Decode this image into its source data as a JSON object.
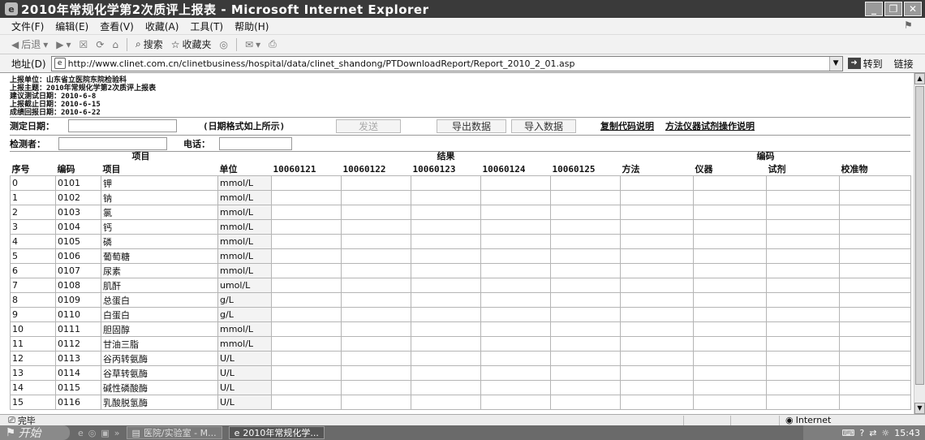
{
  "window": {
    "title": "2010年常规化学第2次质评上报表 - Microsoft Internet Explorer"
  },
  "menu": [
    "文件(F)",
    "编辑(E)",
    "查看(V)",
    "收藏(A)",
    "工具(T)",
    "帮助(H)"
  ],
  "toolbar": {
    "back": "后退",
    "search": "搜索",
    "favorites": "收藏夹"
  },
  "address": {
    "label": "地址(D)",
    "url": "http://www.clinet.com.cn/clinetbusiness/hospital/data/clinet_shandong/PTDownloadReport/Report_2010_2_01.asp",
    "go": "转到",
    "links": "链接"
  },
  "info": [
    "上报单位：山东省立医院东院检验科",
    "上报主题：2010年常规化学第2次质评上报表",
    "建议测试日期：2010-6-8",
    "上报截止日期：2010-6-15",
    "成绩回报日期：2010-6-22"
  ],
  "form": {
    "test_date_label": "测定日期：",
    "date_hint": "(日期格式如上所示)",
    "send": "发送",
    "export": "导出数据",
    "import": "导入数据",
    "code_help": "复制代码说明",
    "method_help": "方法仪器试剂操作说明",
    "tester_label": "检测者：",
    "phone_label": "电话："
  },
  "table": {
    "group_headers": {
      "item": "项目",
      "result": "结果",
      "code": "编码"
    },
    "headers": [
      "序号",
      "编码",
      "项目",
      "单位",
      "10060121",
      "10060122",
      "10060123",
      "10060124",
      "10060125",
      "方法",
      "仪器",
      "试剂",
      "校准物"
    ],
    "rows": [
      [
        "0",
        "0101",
        "钾",
        "mmol/L"
      ],
      [
        "1",
        "0102",
        "钠",
        "mmol/L"
      ],
      [
        "2",
        "0103",
        "氯",
        "mmol/L"
      ],
      [
        "3",
        "0104",
        "钙",
        "mmol/L"
      ],
      [
        "4",
        "0105",
        "磷",
        "mmol/L"
      ],
      [
        "5",
        "0106",
        "葡萄糖",
        "mmol/L"
      ],
      [
        "6",
        "0107",
        "尿素",
        "mmol/L"
      ],
      [
        "7",
        "0108",
        "肌酐",
        "umol/L"
      ],
      [
        "8",
        "0109",
        "总蛋白",
        "g/L"
      ],
      [
        "9",
        "0110",
        "白蛋白",
        "g/L"
      ],
      [
        "10",
        "0111",
        "胆固醇",
        "mmol/L"
      ],
      [
        "11",
        "0112",
        "甘油三脂",
        "mmol/L"
      ],
      [
        "12",
        "0113",
        "谷丙转氨酶",
        "U/L"
      ],
      [
        "13",
        "0114",
        "谷草转氨酶",
        "U/L"
      ],
      [
        "14",
        "0115",
        "碱性磷酸酶",
        "U/L"
      ],
      [
        "15",
        "0116",
        "乳酸脱氢酶",
        "U/L"
      ]
    ]
  },
  "status": {
    "text": "完毕",
    "zone": "Internet"
  },
  "taskbar": {
    "start": "开始",
    "tasks": [
      "医院/实验室 - M...",
      "2010年常规化学..."
    ],
    "time": "15:43"
  }
}
